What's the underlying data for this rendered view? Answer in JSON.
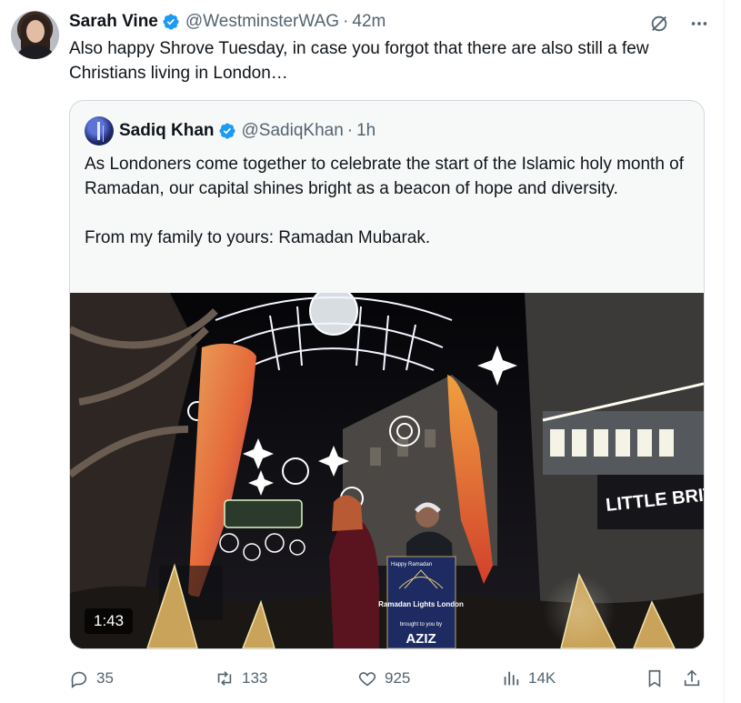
{
  "tweet": {
    "author_name": "Sarah Vine",
    "author_handle": "@WestminsterWAG",
    "separator": "·",
    "time": "42m",
    "text": "Also happy Shrove Tuesday, in case you forgot that there are also still a few Christians living in London…"
  },
  "quoted": {
    "author_name": "Sadiq Khan",
    "author_handle": "@SadiqKhan",
    "separator": "·",
    "time": "1h",
    "paragraph_1": "As Londoners come together to celebrate the start of the Islamic holy month of Ramadan, our capital shines bright as a beacon of hope and diversity.",
    "paragraph_2": "From my family to yours: Ramadan Mubarak.",
    "video": {
      "duration": "1:43",
      "sign_text": "LITTLE BRIT",
      "lectern_text_top": "Happy Ramadan",
      "lectern_text_main": "Ramadan Lights London",
      "lectern_text_sub": "brought to you by",
      "lectern_text_brand": "AZIZ"
    }
  },
  "actions": {
    "replies": "35",
    "reposts": "133",
    "likes": "925",
    "views": "14K"
  },
  "colors": {
    "verified": "#1d9bf0",
    "secondary_text": "#536471",
    "border": "#cfd9de"
  },
  "icons": [
    "verified-icon",
    "grok-icon",
    "more-icon",
    "reply-icon",
    "repost-icon",
    "like-icon",
    "views-icon",
    "bookmark-icon",
    "share-icon"
  ]
}
